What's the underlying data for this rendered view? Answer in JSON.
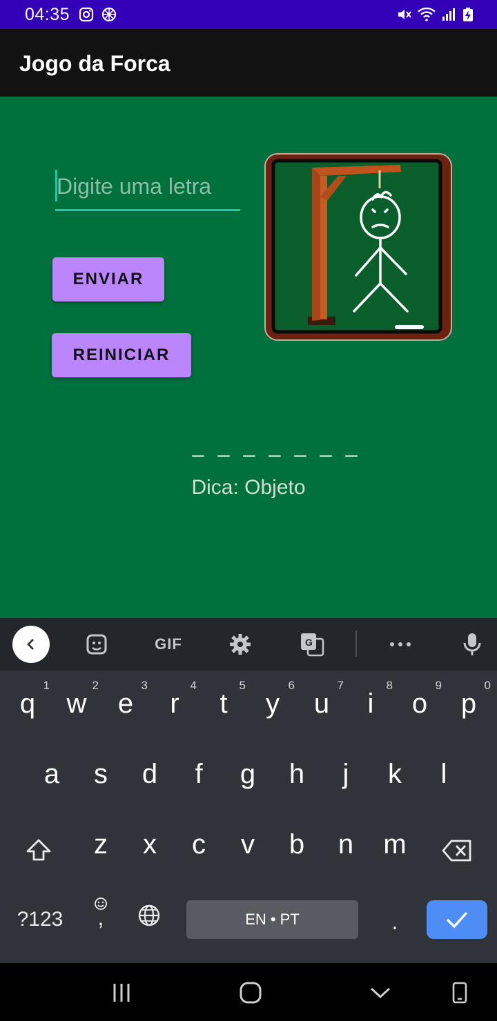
{
  "status_bar": {
    "time": "04:35",
    "left_icons": [
      "instagram-icon",
      "settings-wheel-icon"
    ],
    "right_icons": [
      "mute-icon",
      "wifi-icon",
      "signal-icon",
      "battery-charging-icon"
    ],
    "background": "#3300b8"
  },
  "app_bar": {
    "title": "Jogo da Forca",
    "background": "#121212"
  },
  "content": {
    "background": "#00703c",
    "input": {
      "placeholder": "Digite uma letra",
      "value": ""
    },
    "send_label": "ENVIAR",
    "restart_label": "REINICIAR",
    "word_mask": "_ _ _ _ _ _ _",
    "hint": "Dica: Objeto",
    "button_color": "#bb86fc",
    "accent": "#20c9a4"
  },
  "keyboard": {
    "toolbar": {
      "gif_label": "GIF",
      "icons": [
        "back-icon",
        "sticker-icon",
        "gif-icon",
        "settings-gear-icon",
        "translate-icon",
        "more-icon",
        "microphone-icon"
      ]
    },
    "row1": [
      {
        "ch": "q",
        "num": "1"
      },
      {
        "ch": "w",
        "num": "2"
      },
      {
        "ch": "e",
        "num": "3"
      },
      {
        "ch": "r",
        "num": "4"
      },
      {
        "ch": "t",
        "num": "5"
      },
      {
        "ch": "y",
        "num": "6"
      },
      {
        "ch": "u",
        "num": "7"
      },
      {
        "ch": "i",
        "num": "8"
      },
      {
        "ch": "o",
        "num": "9"
      },
      {
        "ch": "p",
        "num": "0"
      }
    ],
    "row2": [
      "a",
      "s",
      "d",
      "f",
      "g",
      "h",
      "j",
      "k",
      "l"
    ],
    "row3": [
      "z",
      "x",
      "c",
      "v",
      "b",
      "n",
      "m"
    ],
    "symbols_label": "?123",
    "comma_label": ",",
    "space_label": "EN • PT",
    "period_label": ".",
    "enter_color": "#4e8df5"
  },
  "nav_bar": {
    "icons": [
      "recents-icon",
      "home-icon",
      "back-chevron-icon",
      "rotate-icon"
    ]
  }
}
